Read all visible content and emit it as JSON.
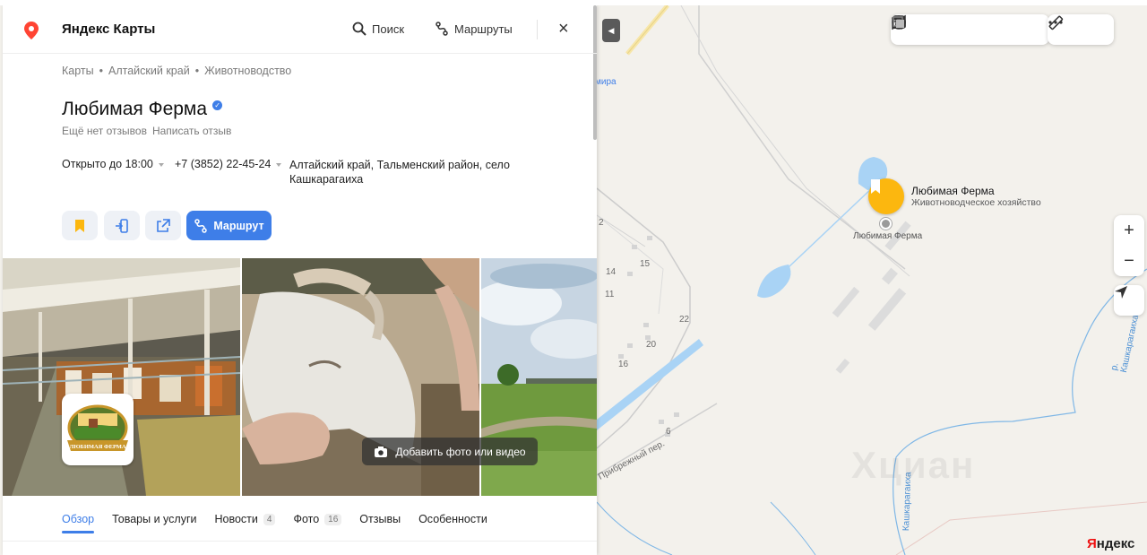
{
  "map": {
    "place_label": "Любимая Ферма",
    "place_category": "Животноводческое хозяйство",
    "place_under_label": "Любимая Ферма",
    "street_label": "Прибрежный пер.",
    "river_label_1": "р. Кашкарагаиха",
    "river_label_2": "Кашкарагаиха",
    "road_label": "мира",
    "house_numbers": [
      "2",
      "14",
      "15",
      "11",
      "22",
      "20",
      "16",
      "6"
    ],
    "brand": "Яндекс",
    "watermark": "Хциан",
    "zoom_in": "+",
    "zoom_out": "−"
  },
  "panel": {
    "brand": "Яндекс Карты",
    "search_label": "Поиск",
    "routes_label": "Маршруты",
    "close": "×",
    "breadcrumbs": [
      "Карты",
      "Алтайский край",
      "Животноводство"
    ],
    "breadcrumb_sep": "•",
    "title": "Любимая Ферма",
    "no_reviews": "Ещё нет отзывов",
    "write_review": "Написать отзыв",
    "hours": "Открыто до 18:00",
    "phone": "+7 (3852) 22-45-24",
    "address": "Алтайский край, Тальменский район, село Кашкарагаиха",
    "route_button": "Маршрут",
    "add_photo": "Добавить фото или видео",
    "farm_logo_text": "ЛЮБИМАЯ ФЕРМА",
    "tabs": [
      {
        "label": "Обзор",
        "count": ""
      },
      {
        "label": "Товары и услуги",
        "count": ""
      },
      {
        "label": "Новости",
        "count": "4"
      },
      {
        "label": "Фото",
        "count": "16"
      },
      {
        "label": "Отзывы",
        "count": ""
      },
      {
        "label": "Особенности",
        "count": ""
      }
    ]
  },
  "colors": {
    "accent": "#3e7ee8",
    "pin": "#fcb70f",
    "water": "#a9d3f5",
    "logo_red": "#e11"
  }
}
